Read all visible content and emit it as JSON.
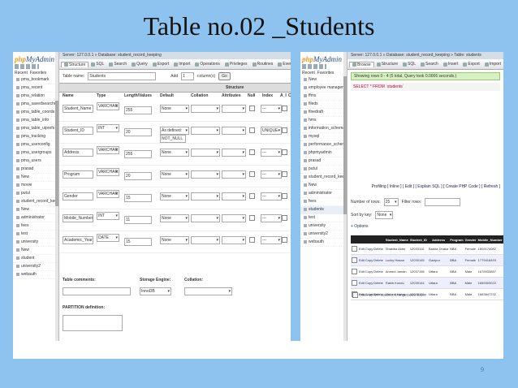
{
  "slide": {
    "title": "Table no.02 _Students",
    "page_number": "9"
  },
  "left": {
    "logo": {
      "php": "php",
      "my": "MyAdmin"
    },
    "sidebar_tabs": [
      "Recent",
      "Favorites"
    ],
    "sidebar_items": [
      "pma_bookmark",
      "pma_recent",
      "pma_relation",
      "pma_savedsearches",
      "pma_table_coords",
      "pma_table_info",
      "pma_table_uiprefs",
      "pma_tracking",
      "pma_userconfig",
      "pma_usergroups",
      "pma_users",
      "prasad",
      "New",
      "movie",
      "putul",
      "student_record_keeping",
      "New",
      "administrator",
      "fees",
      "test",
      "university",
      "New",
      "student",
      "university2",
      "webauth"
    ],
    "breadcrumb": "Server: 127.0.0.1 » Database: student_record_keeping",
    "tabs": [
      "Structure",
      "SQL",
      "Search",
      "Query",
      "Export",
      "Import",
      "Operations",
      "Privileges",
      "Routines",
      "Events",
      "More"
    ],
    "table_name_label": "Table name:",
    "table_name_value": "Students",
    "add_label": "Add",
    "add_value": "1",
    "columns_label": "column(s)",
    "go_label": "Go",
    "structure_label": "Structure",
    "headers": [
      "Name",
      "Type",
      "Length/Values",
      "Default",
      "Collation",
      "Attributes",
      "Null",
      "Index",
      "A_I",
      "Co"
    ],
    "fields": [
      {
        "name": "Student_Name",
        "type": "VARCHAR",
        "length": "255",
        "default": "None",
        "index": "---"
      },
      {
        "name": "Student_ID",
        "type": "INT",
        "length": "20",
        "default": "As defined:",
        "default_extra": "NOT_NULL",
        "index": "UNIQUE"
      },
      {
        "name": "Address",
        "type": "VARCHAR",
        "length": "255",
        "default": "None",
        "index": "---"
      },
      {
        "name": "Program",
        "type": "VARCHAR",
        "length": "20",
        "default": "None",
        "index": "---"
      },
      {
        "name": "Gender",
        "type": "VARCHAR",
        "length": "15",
        "default": "None",
        "index": "---"
      },
      {
        "name": "Mobile_Number",
        "type": "INT",
        "length": "11",
        "default": "None",
        "index": "---"
      },
      {
        "name": "Academic_Year",
        "type": "DATE",
        "length": "15",
        "default": "None",
        "index": "---"
      }
    ],
    "table_comments_label": "Table comments:",
    "storage_engine_label": "Storage Engine:",
    "storage_engine_value": "InnoDB",
    "collation_label": "Collation:",
    "partition_label": "PARTITION definition:"
  },
  "right": {
    "logo": {
      "php": "php",
      "my": "MyAdmin"
    },
    "sidebar_tabs": [
      "Recent",
      "Favorites"
    ],
    "sidebar_items": [
      "New",
      "employee management system",
      "ffms",
      "fileds",
      "finedraft",
      "hms",
      "information_schema",
      "mysql",
      "performance_schema",
      "phpmyadmin",
      "prasad",
      "putul",
      "student_record_keeping",
      "New",
      "administrator",
      "fees",
      "students",
      "test",
      "university",
      "university2",
      "webauth"
    ],
    "breadcrumb": "Server: 127.0.0.1 » Database: student_record_keeping » Table: students",
    "tabs": [
      "Browse",
      "Structure",
      "SQL",
      "Search",
      "Insert",
      "Export",
      "Import",
      "Privileges",
      "Operations",
      "Tracking",
      "Triggers"
    ],
    "showing": "Showing rows 0 - 4 (5 total, Query took 0.0006 seconds.)",
    "sql": "SELECT * FROM `students`",
    "profiling": "Profiling [ Inline ] [ Edit ] [ Explain SQL ] [ Create PHP Code ] [ Refresh ]",
    "number_rows_label": "Number of rows:",
    "number_rows_value": "25",
    "filter_label": "Filter rows:",
    "sort_label": "Sort by key:",
    "sort_value": "None",
    "options": "+ Options",
    "columns": [
      "Student_Name",
      "Student_ID",
      "Address",
      "Program",
      "Gender",
      "Mobile_Number",
      "Academic_Year"
    ],
    "row_actions": [
      "Edit",
      "Copy",
      "Delete"
    ],
    "rows": [
      {
        "name": "Shakiba Akter",
        "id": "12033116",
        "address": "Badda Dhaka",
        "program": "BBA",
        "gender": "Female",
        "mobile": "1804174082",
        "year": "2016-12-31"
      },
      {
        "name": "Lucky Hasan",
        "id": "12030145",
        "address": "Gazipur",
        "program": "BBA",
        "gender": "Female",
        "mobile": "1779418493",
        "year": "2016-12-31"
      },
      {
        "name": "Ahmed Jaman",
        "id": "12037198",
        "address": "Uttara",
        "program": "BBA",
        "gender": "Male",
        "mobile": "1678933857",
        "year": "2016-12-31"
      },
      {
        "name": "Rakib Kundu",
        "id": "12035144",
        "address": "Uttara",
        "program": "BBA",
        "gender": "Male",
        "mobile": "1659303022",
        "year": "2016-12-31"
      },
      {
        "name": "Mehedi Hasan",
        "id": "12035109",
        "address": "Uttara",
        "program": "BBA",
        "gender": "Male",
        "mobile": "1663847232",
        "year": "2016-12-31"
      }
    ],
    "check_all": "Check all",
    "with_selected": "With selected:",
    "change": "Change",
    "delete": "Delete",
    "export": "Export"
  }
}
